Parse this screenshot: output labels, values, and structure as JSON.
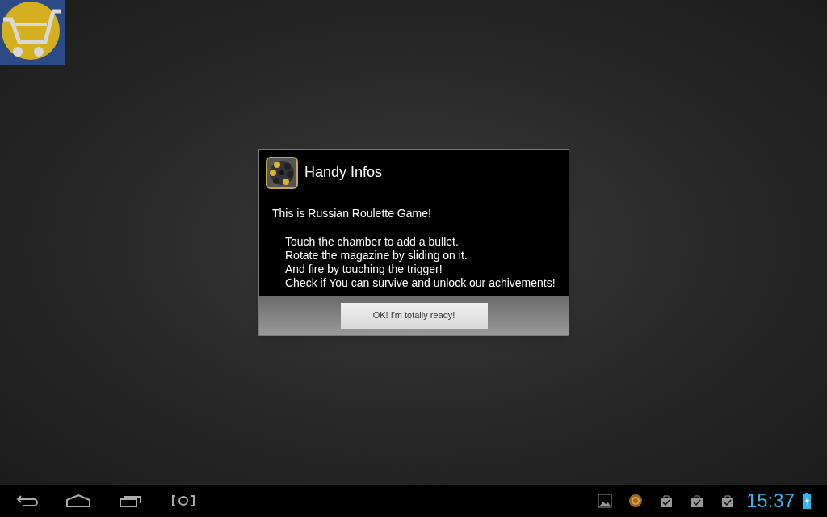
{
  "dialog": {
    "title": "Handy Infos",
    "intro": "This is Russian Roulette Game!",
    "lines": [
      "Touch the chamber to add a bullet.",
      "Rotate the magazine by sliding on it.",
      "And fire by touching the trigger!",
      "Check if You can survive and unlock our achivements!"
    ],
    "button": "OK! I'm totally ready!"
  },
  "status_bar": {
    "clock": "15:37"
  }
}
